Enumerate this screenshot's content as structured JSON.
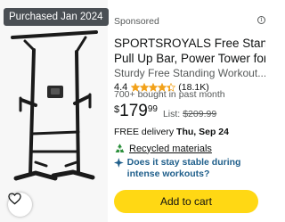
{
  "image": {
    "badge": "Purchased Jan 2024",
    "wishlist_icon": "heart-icon"
  },
  "product": {
    "sponsored_label": "Sponsored",
    "title_line1": "SPORTSROYALS Free Standing",
    "title_line2": "Pull Up Bar, Power Tower for...",
    "subtitle": "Sturdy Free Standing Workout...",
    "rating": "4.4",
    "stars": 4.4,
    "review_count": "(18.1K)",
    "bought": "700+ bought in past month",
    "price_symbol": "$",
    "price_whole": "179",
    "price_fraction": "99",
    "list_label": "List:",
    "list_price": "$209.99",
    "delivery_prefix": "FREE delivery",
    "delivery_date": "Thu, Sep 24",
    "recycled_label": "Recycled materials",
    "question": "Does it stay stable during intense workouts?",
    "cart_label": "Add to cart"
  },
  "colors": {
    "star": "#f2a21b",
    "button": "#ffd814",
    "link": "#1f5f8b",
    "recycle": "#2a8f3a"
  }
}
